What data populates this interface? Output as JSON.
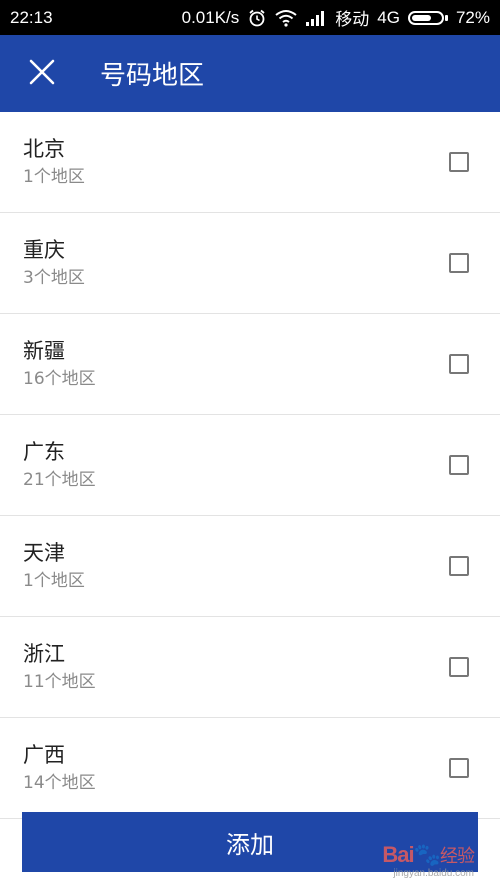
{
  "status_bar": {
    "time": "22:13",
    "speed": "0.01K/s",
    "carrier": "移动",
    "network": "4G",
    "battery_percent": "72%",
    "battery_level": 0.72,
    "icons": [
      "alarm-icon",
      "wifi-icon",
      "signal-icon",
      "battery-icon"
    ]
  },
  "app_bar": {
    "title": "号码地区",
    "close_icon": "close-icon",
    "background": "#1f47a8"
  },
  "regions": [
    {
      "name": "北京",
      "count": "1个地区"
    },
    {
      "name": "重庆",
      "count": "3个地区"
    },
    {
      "name": "新疆",
      "count": "16个地区"
    },
    {
      "name": "广东",
      "count": "21个地区"
    },
    {
      "name": "天津",
      "count": "1个地区"
    },
    {
      "name": "浙江",
      "count": "11个地区"
    },
    {
      "name": "广西",
      "count": "14个地区"
    }
  ],
  "footer": {
    "add_label": "添加"
  },
  "watermark": {
    "brand_left": "Bai",
    "brand_right": "经验",
    "url": "jingyan.baidu.com"
  }
}
